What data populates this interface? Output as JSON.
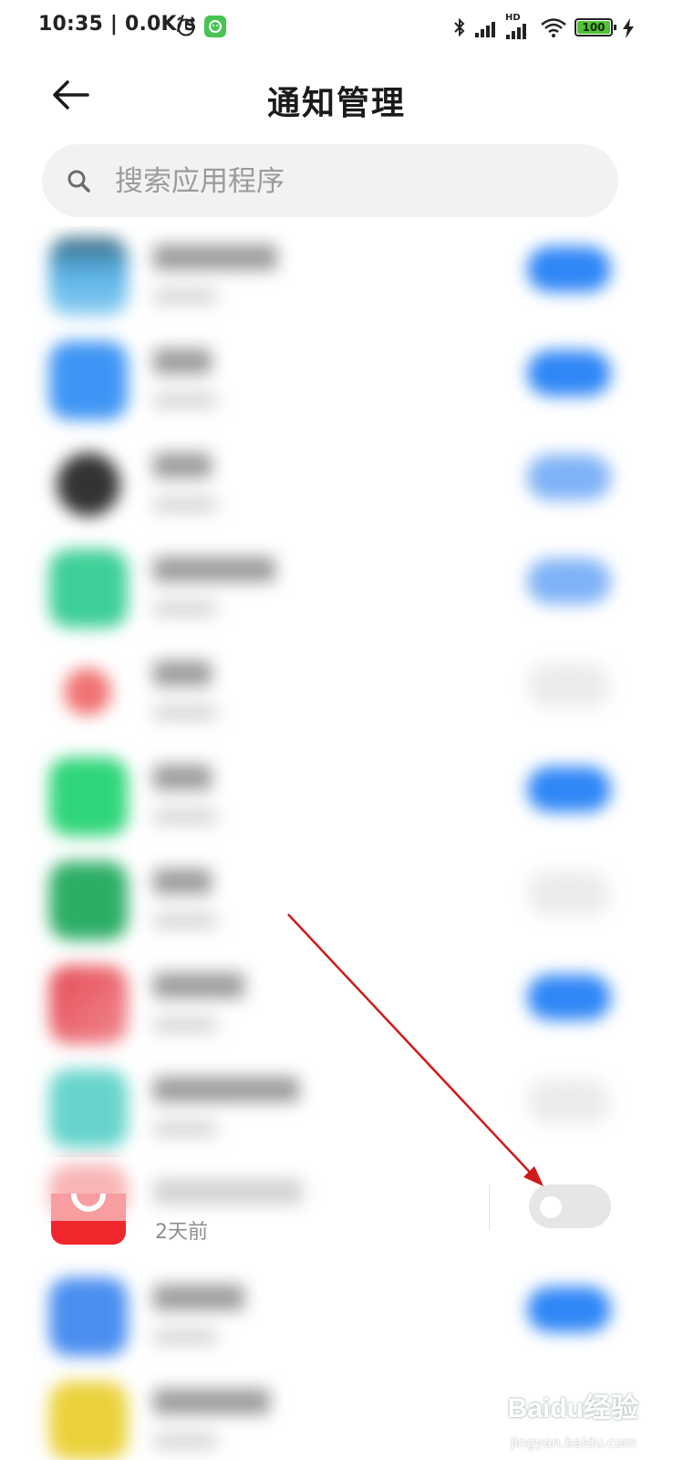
{
  "status_bar": {
    "time": "10:35 | 0.0K/s",
    "battery": "100",
    "signal_label": "HD"
  },
  "header": {
    "back_icon": "arrow-left-icon",
    "title": "通知管理"
  },
  "search": {
    "placeholder": "搜索应用程序",
    "value": ""
  },
  "app_list": {
    "rows": [
      {
        "icon_color": "#58b0e6",
        "notifications": "on"
      },
      {
        "icon_color": "#3f95f5",
        "notifications": "on"
      },
      {
        "icon_color": "#333333",
        "notifications": "on-light"
      },
      {
        "icon_color": "#3ecf98",
        "notifications": "on-light"
      },
      {
        "icon_color": "#f07272",
        "notifications": "off"
      },
      {
        "icon_color": "#2fd57a",
        "notifications": "on"
      },
      {
        "icon_color": "#2cae66",
        "notifications": "off"
      },
      {
        "icon_color": "#e64a55",
        "notifications": "on"
      },
      {
        "icon_color": "#67d4cc",
        "notifications": "off"
      },
      {
        "icon_color": "#f03e44",
        "notifications": "off",
        "subtitle": "2天前"
      },
      {
        "icon_color": "#4a8ef0",
        "notifications": "on"
      },
      {
        "icon_color": "#ebd23c",
        "notifications": "on"
      }
    ]
  },
  "focused_row": {
    "subtitle": "2天前",
    "notifications": "off"
  },
  "annotation": {
    "arrow_color": "#d01818"
  },
  "watermark": {
    "brand": "Baidu经验",
    "domain": "jingyan.baidu.com"
  }
}
